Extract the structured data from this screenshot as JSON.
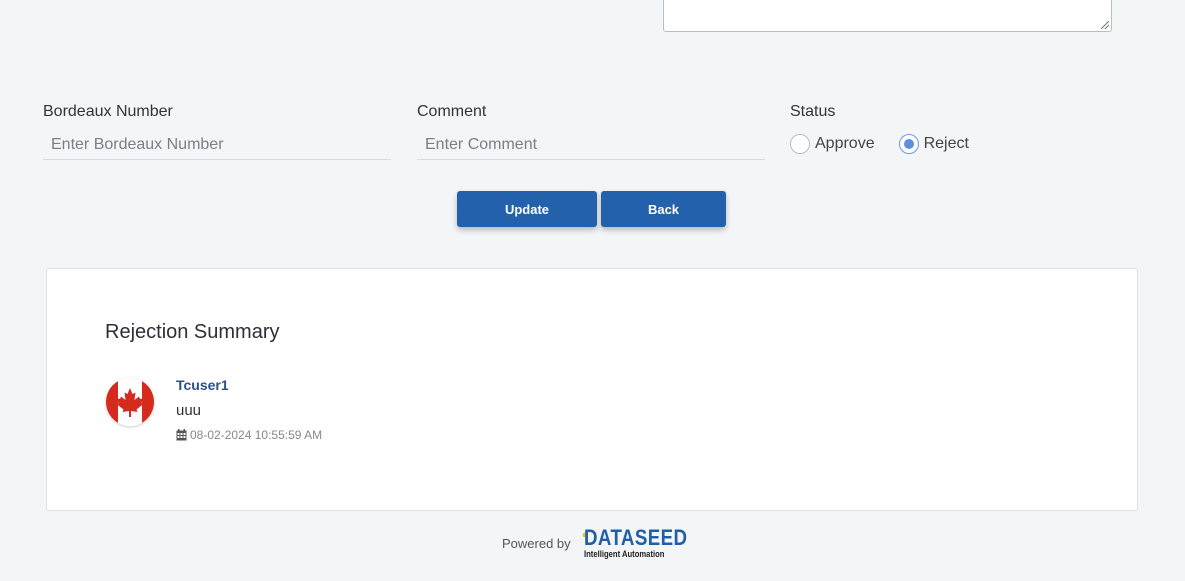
{
  "form": {
    "bordeaux_label": "Bordeaux Number",
    "bordeaux_placeholder": "Enter Bordeaux Number",
    "comment_label": "Comment",
    "comment_placeholder": "Enter Comment",
    "status_label": "Status",
    "status_options": [
      "Approve",
      "Reject"
    ],
    "status_selected": "Reject"
  },
  "buttons": {
    "update_label": "Update",
    "back_label": "Back"
  },
  "summary": {
    "title": "Rejection Summary",
    "entries": [
      {
        "avatar_icon": "canada-flag-icon",
        "user": "Tcuser1",
        "comment": "uuu",
        "timestamp": "08-02-2024 10:55:59 AM"
      }
    ]
  },
  "footer": {
    "powered_by": "Powered by",
    "brand_name": "DATASEED",
    "brand_tagline": "Intelligent Automation"
  },
  "colors": {
    "primary": "#2361ad",
    "link": "#2d4f8b",
    "radio_accent": "#5d8fdc"
  }
}
